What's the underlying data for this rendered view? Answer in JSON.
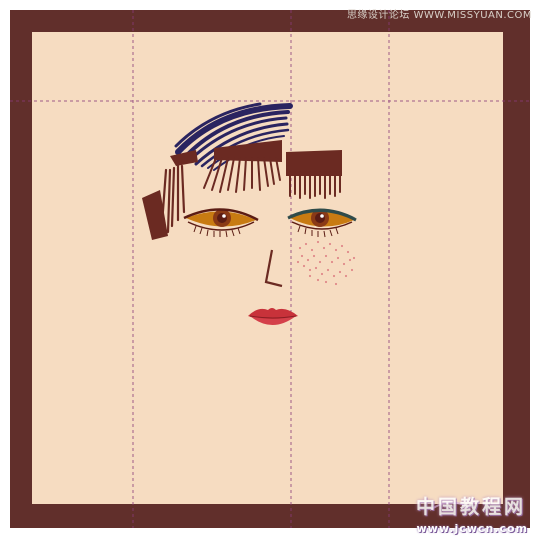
{
  "artwork": {
    "colors": {
      "outer_frame": "#612f2b",
      "canvas": "#f6dcc1",
      "guide_line": "#8a3a7a",
      "hair_dark": "#6b2a22",
      "hair_blue": "#2a2460",
      "iris": "#c87b12",
      "pupil": "#5b1c14",
      "eyelid_shadow": "#2f4b4a",
      "lips": "#c8323a",
      "freckles": "#e08a8a"
    }
  },
  "watermark": {
    "top": "思缘设计论坛 WWW.MISSYUAN.COM",
    "bottom_cn": "中国教程网",
    "bottom_url": "www.jcwcn.com"
  }
}
